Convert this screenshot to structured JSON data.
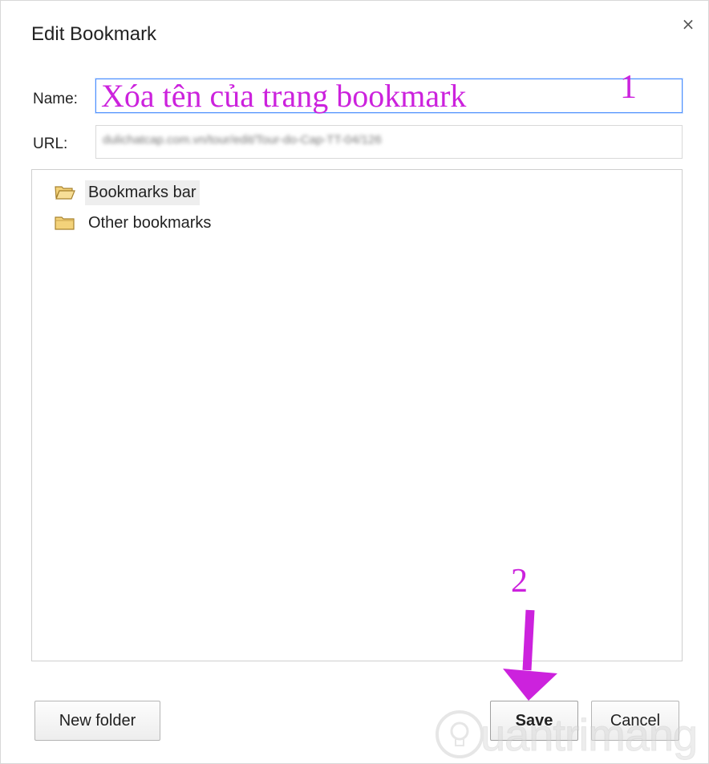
{
  "dialog": {
    "title": "Edit Bookmark",
    "close_symbol": "×",
    "name_label": "Name:",
    "name_value": "Xóa tên của trang bookmark",
    "url_label": "URL:",
    "url_value": "dulichatcap.com.vn/tour/edit/Tour-do-Cap-TT-04/126"
  },
  "folders": [
    {
      "label": "Bookmarks bar",
      "icon": "folder-open-icon",
      "selected": true
    },
    {
      "label": "Other bookmarks",
      "icon": "folder-icon",
      "selected": false
    }
  ],
  "buttons": {
    "new_folder": "New folder",
    "save": "Save",
    "cancel": "Cancel"
  },
  "annotations": {
    "step1": "1",
    "step2": "2",
    "color": "#cc22dd"
  },
  "watermark": {
    "text": "uantrimang",
    "icon": "lightbulb-icon"
  },
  "colors": {
    "focus_border": "#4d90fe",
    "selection_bg": "#eeeeee",
    "folder_fill": "#f3d27a"
  }
}
